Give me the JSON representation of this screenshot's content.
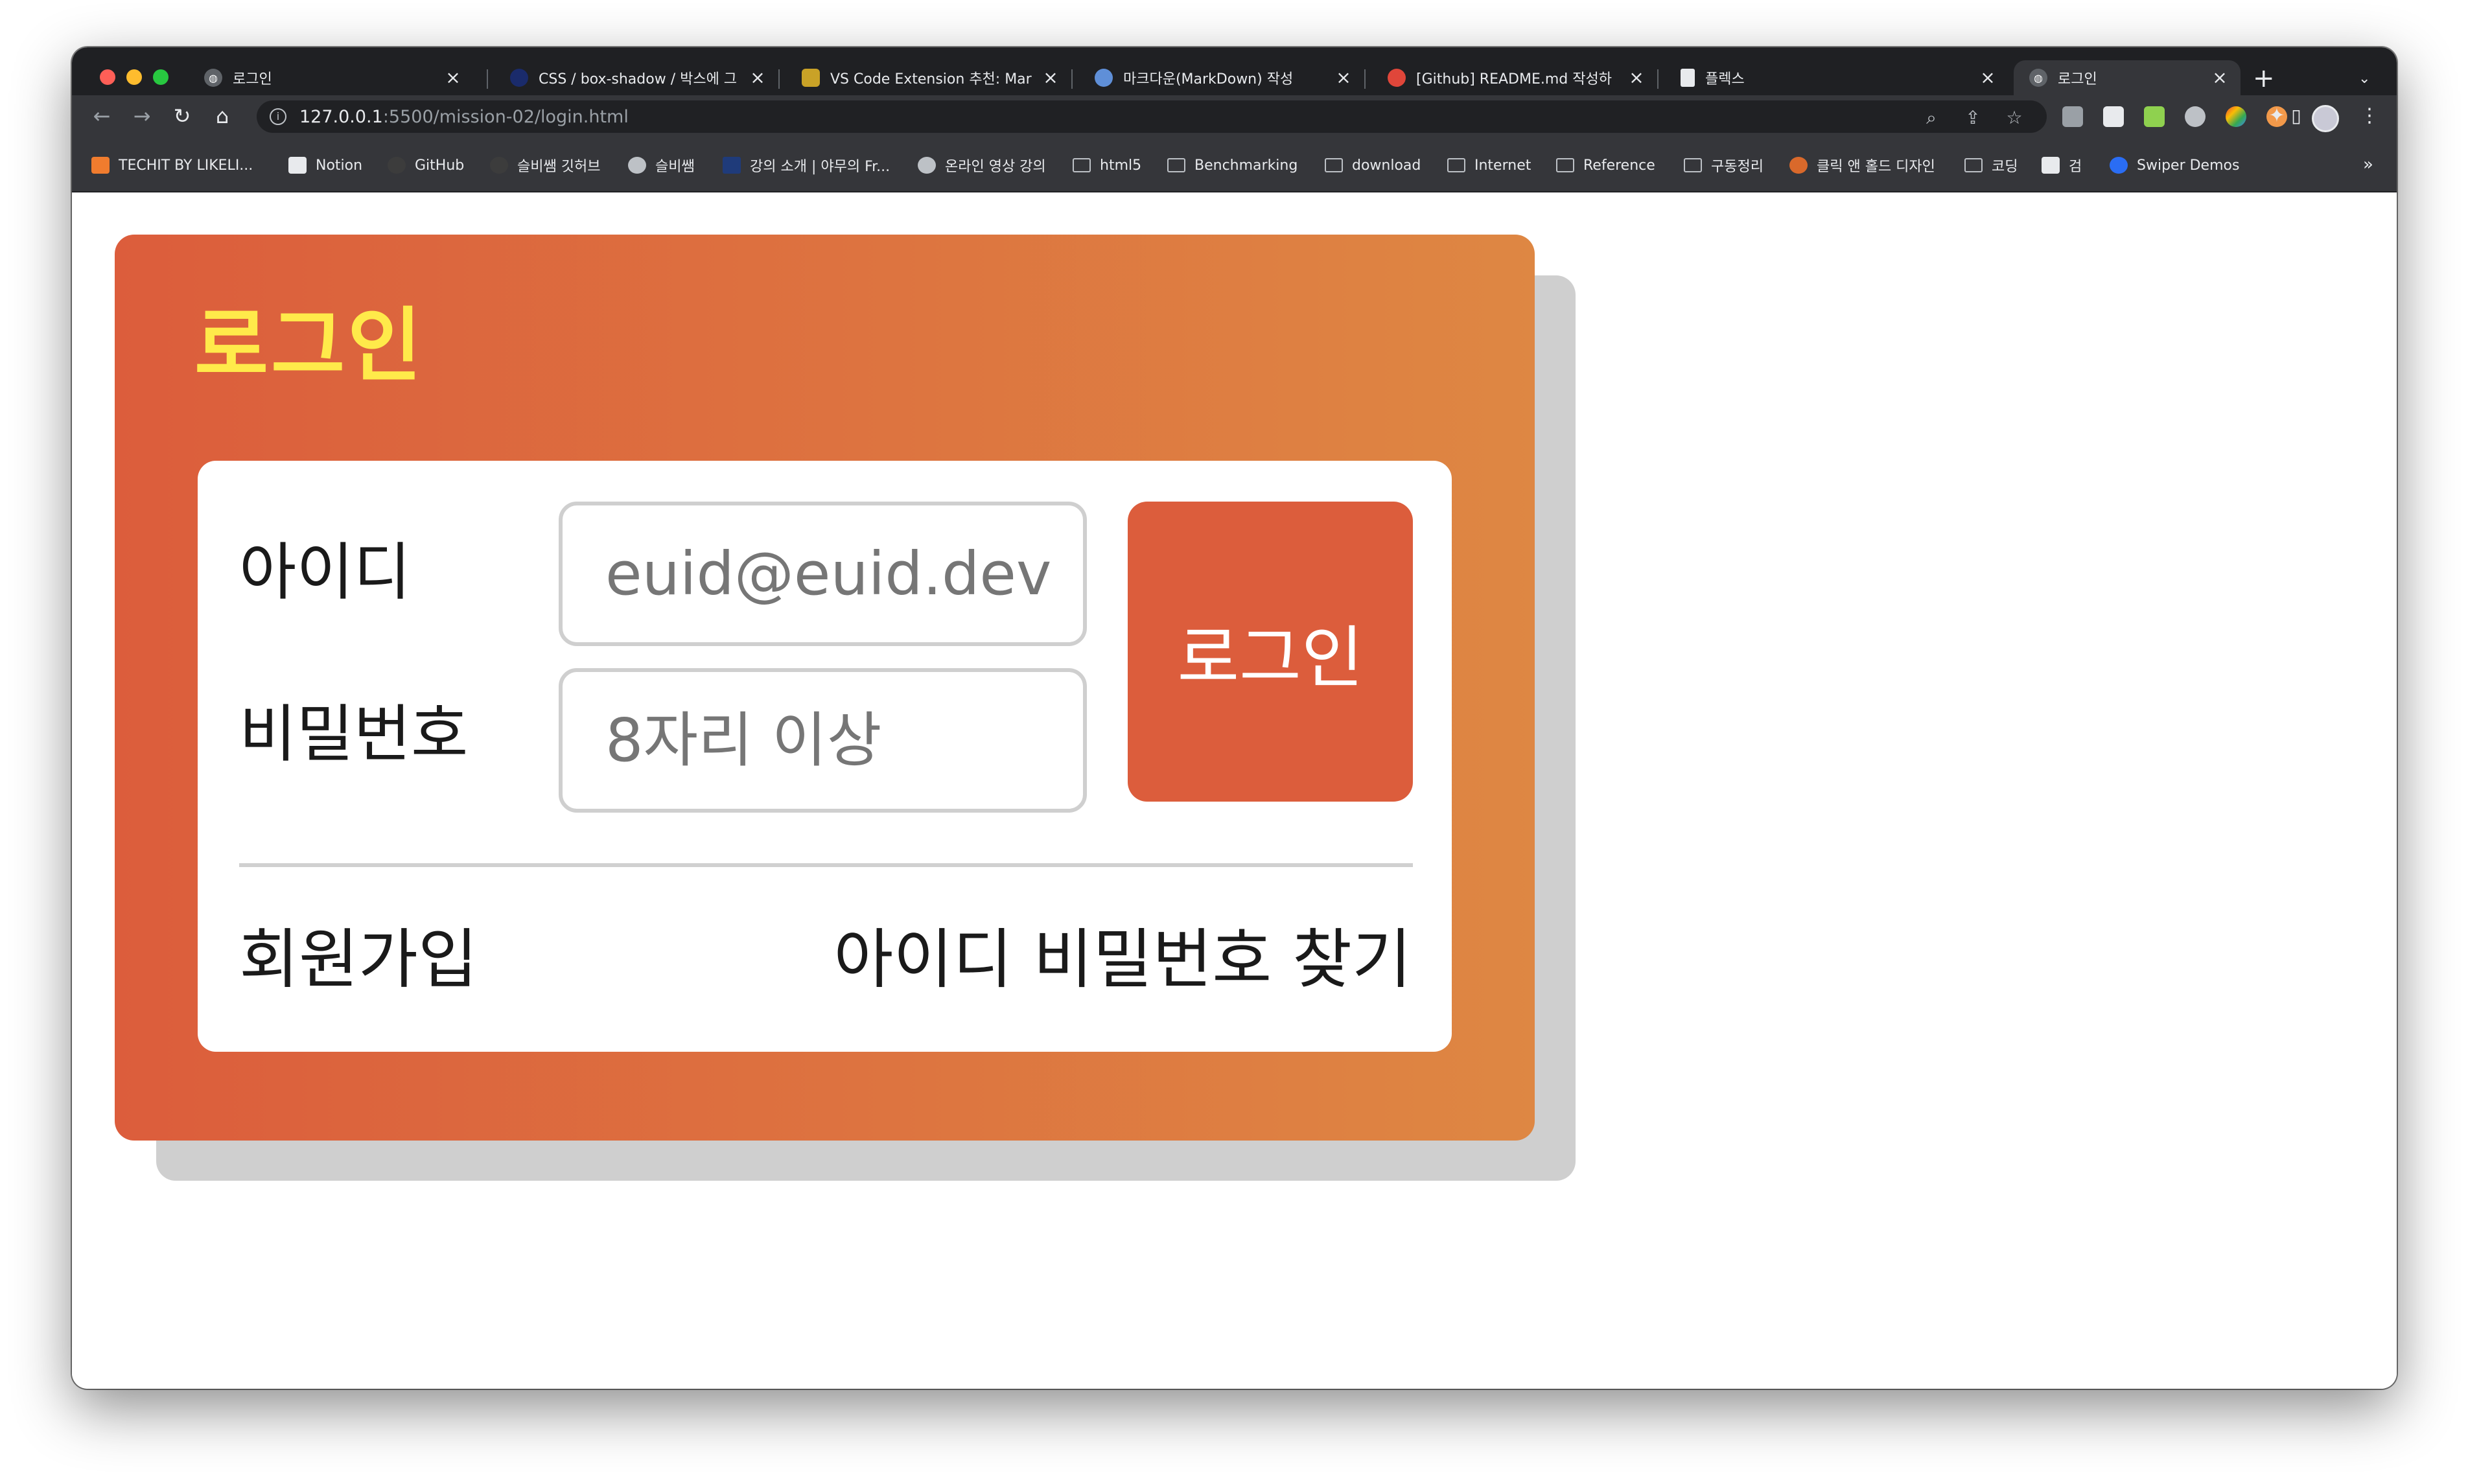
{
  "browser": {
    "tabs": [
      {
        "label": "로그인",
        "icon": "globe-icon",
        "color": "#5f6368"
      },
      {
        "label": "CSS / box-shadow / 박스에 그",
        "icon": "site-icon",
        "color": "#1a73e8"
      },
      {
        "label": "VS Code Extension 추천: Mar",
        "icon": "site-icon",
        "color": "#c9a227"
      },
      {
        "label": "마크다운(MarkDown) 작성",
        "icon": "site-icon",
        "color": "#5f8fd8"
      },
      {
        "label": "[Github] README.md 작성하",
        "icon": "site-icon",
        "color": "#e0463a"
      },
      {
        "label": "플렉스",
        "icon": "document-icon",
        "color": "#e8eaed"
      },
      {
        "label": "로그인",
        "icon": "globe-icon",
        "color": "#5f6368"
      }
    ],
    "url_host": "127.0.0.1",
    "url_path": ":5500/mission-02/login.html",
    "bookmarks": [
      {
        "label": "TECHIT BY LIKELI...",
        "icon": "techit-icon"
      },
      {
        "label": "Notion",
        "icon": "notion-icon"
      },
      {
        "label": "GitHub",
        "icon": "github-icon"
      },
      {
        "label": "슬비쌤 깃허브",
        "icon": "github-icon"
      },
      {
        "label": "슬비쌤",
        "icon": "site-icon"
      },
      {
        "label": "강의 소개 | 야무의 Fr...",
        "icon": "site-icon"
      },
      {
        "label": "온라인 영상 강의",
        "icon": "site-icon"
      },
      {
        "label": "html5",
        "icon": "folder-icon"
      },
      {
        "label": "Benchmarking",
        "icon": "folder-icon"
      },
      {
        "label": "download",
        "icon": "folder-icon"
      },
      {
        "label": "Internet",
        "icon": "folder-icon"
      },
      {
        "label": "Reference",
        "icon": "folder-icon"
      },
      {
        "label": "구동정리",
        "icon": "folder-icon"
      },
      {
        "label": "클릭 앤 홀드 디자인",
        "icon": "site-icon"
      },
      {
        "label": "코딩",
        "icon": "folder-icon"
      },
      {
        "label": "검",
        "icon": "site-icon"
      },
      {
        "label": "Swiper Demos",
        "icon": "swiper-icon"
      }
    ],
    "bookmarks_more": "»"
  },
  "page": {
    "title": "로그인",
    "id_label": "아이디",
    "id_placeholder": "euid@euid.dev",
    "pw_label": "비밀번호",
    "pw_placeholder": "8자리 이상",
    "login_button": "로그인",
    "signup_link": "회원가입",
    "find_link": "아이디 비밀번호 찾기"
  },
  "colors": {
    "accent": "#dc5d3c",
    "gradient_end": "#de8743",
    "title": "#ffea4a"
  }
}
